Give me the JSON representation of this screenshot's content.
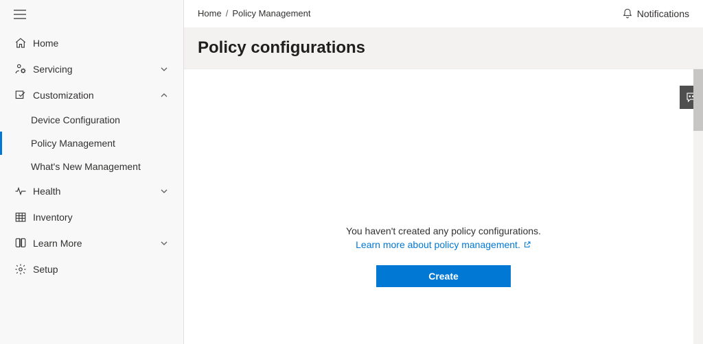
{
  "sidebar": {
    "items": [
      {
        "label": "Home"
      },
      {
        "label": "Servicing"
      },
      {
        "label": "Customization"
      },
      {
        "label": "Health"
      },
      {
        "label": "Inventory"
      },
      {
        "label": "Learn More"
      },
      {
        "label": "Setup"
      }
    ],
    "customization_sub": [
      {
        "label": "Device Configuration"
      },
      {
        "label": "Policy Management"
      },
      {
        "label": "What's New Management"
      }
    ]
  },
  "breadcrumb": {
    "home": "Home",
    "sep": "/",
    "current": "Policy Management"
  },
  "notifications_label": "Notifications",
  "page_title": "Policy configurations",
  "empty": {
    "message": "You haven't created any policy configurations.",
    "link": "Learn more about policy management.",
    "button": "Create"
  }
}
